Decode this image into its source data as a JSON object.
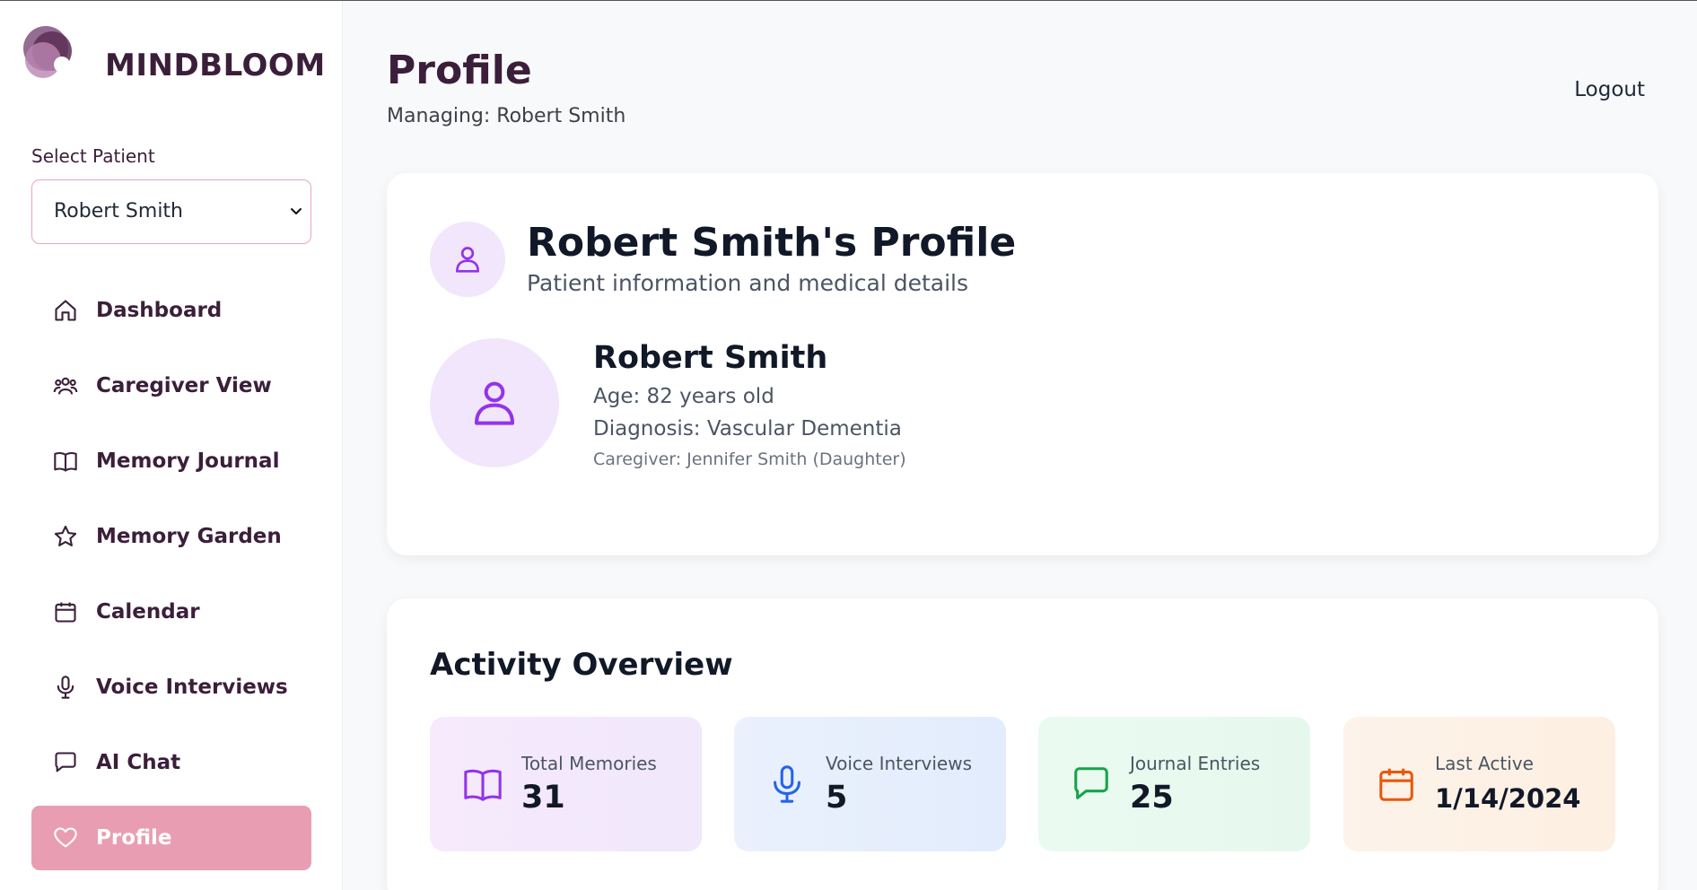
{
  "app": {
    "name": "MINDBLOOM"
  },
  "sidebar": {
    "select_label": "Select Patient",
    "selected_patient": "Robert Smith",
    "items": [
      {
        "label": "Dashboard",
        "icon": "home-icon"
      },
      {
        "label": "Caregiver View",
        "icon": "users-icon"
      },
      {
        "label": "Memory Journal",
        "icon": "book-icon"
      },
      {
        "label": "Memory Garden",
        "icon": "star-icon"
      },
      {
        "label": "Calendar",
        "icon": "calendar-icon"
      },
      {
        "label": "Voice Interviews",
        "icon": "mic-icon"
      },
      {
        "label": "AI Chat",
        "icon": "chat-icon"
      },
      {
        "label": "Profile",
        "icon": "heart-icon",
        "active": true
      }
    ]
  },
  "header": {
    "title": "Profile",
    "managing": "Managing: Robert Smith",
    "logout": "Logout"
  },
  "profile": {
    "title": "Robert Smith's Profile",
    "subtitle": "Patient information and medical details",
    "name": "Robert Smith",
    "age": "Age: 82 years old",
    "diagnosis": "Diagnosis: Vascular Dementia",
    "caregiver": "Caregiver: Jennifer Smith (Daughter)"
  },
  "activity": {
    "title": "Activity Overview",
    "stats": [
      {
        "label": "Total Memories",
        "value": "31",
        "icon": "book-icon",
        "color": "#9333ea"
      },
      {
        "label": "Voice Interviews",
        "value": "5",
        "icon": "mic-icon",
        "color": "#2563eb"
      },
      {
        "label": "Journal Entries",
        "value": "25",
        "icon": "chat-icon",
        "color": "#16a34a"
      },
      {
        "label": "Last Active",
        "value": "1/14/2024",
        "icon": "calendar-icon",
        "color": "#ea580c"
      }
    ]
  },
  "colors": {
    "brand": "#3b1f3a",
    "active_nav": "#e99db3",
    "select_border": "#e7a6be",
    "avatar_bg": "#f1e6fb",
    "avatar_icon": "#9333ea"
  }
}
